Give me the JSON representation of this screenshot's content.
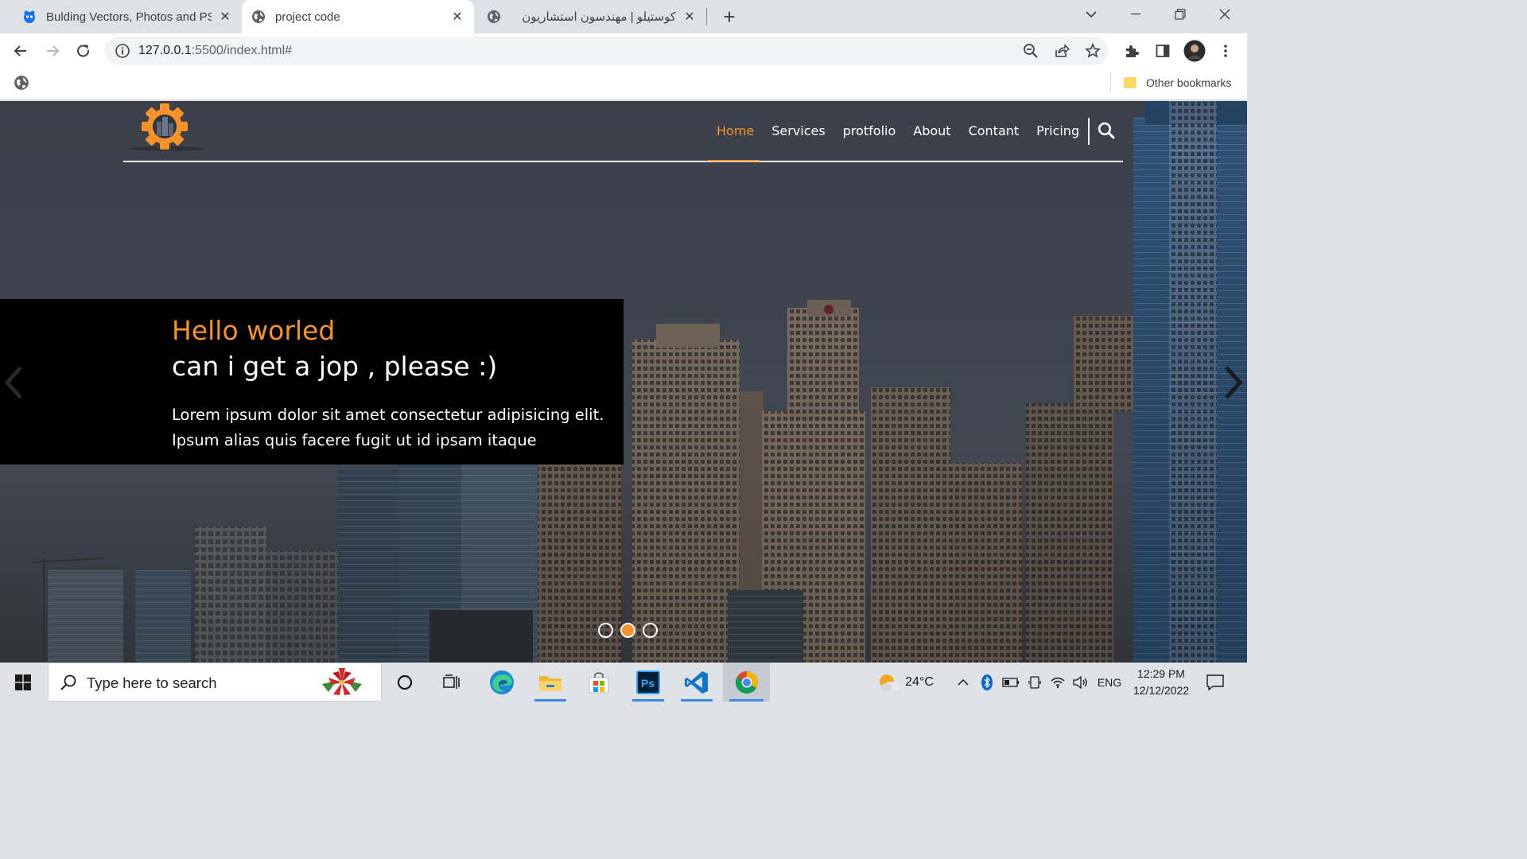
{
  "browser": {
    "tabs": [
      {
        "title": "Bulding Vectors, Photos and PSD",
        "icon": "freepik-favicon-icon",
        "active": false
      },
      {
        "title": "project code",
        "icon": "globe-icon",
        "active": true
      },
      {
        "title": "كوستيلو | مهندسون استشاريون",
        "icon": "globe-icon",
        "active": false
      }
    ],
    "url_host": "127.0.0.1",
    "url_rest": ":5500/index.html#",
    "bookmarks": {
      "other_label": "Other bookmarks"
    }
  },
  "page": {
    "nav": {
      "links": [
        "Home",
        "Services",
        "protfolio",
        "About",
        "Contant",
        "Pricing"
      ],
      "active_link": "Home",
      "accent": "#f5922a"
    },
    "caption": {
      "hello": "Hello worled",
      "title": "can i get a jop , please :)",
      "body": "Lorem ipsum dolor sit amet consectetur adipisicing elit. Ipsum alias quis facere fugit ut id ipsam itaque"
    },
    "carousel": {
      "slide_count": 3,
      "active_index": 1
    }
  },
  "taskbar": {
    "search_placeholder": "Type here to search",
    "weather": "24°C",
    "language": "ENG",
    "time": "12:29 PM",
    "date": "12/12/2022",
    "apps": [
      "cortana-icon",
      "task-view-icon",
      "edge-icon",
      "file-explorer-icon",
      "microsoft-store-icon",
      "photoshop-icon",
      "vscode-icon",
      "chrome-icon"
    ]
  }
}
